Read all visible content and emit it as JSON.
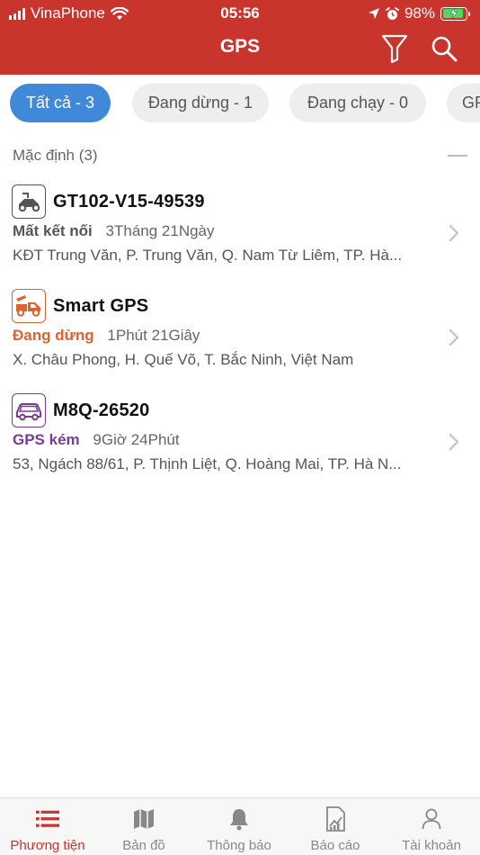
{
  "status_bar": {
    "carrier": "VinaPhone",
    "time": "05:56",
    "battery": "98%"
  },
  "header": {
    "title": "GPS",
    "filter_icon": "filter-icon",
    "search_icon": "search-icon"
  },
  "filters": [
    {
      "label": "Tất cả - 3",
      "active": true
    },
    {
      "label": "Đang dừng - 1",
      "active": false
    },
    {
      "label": "Đang chạy - 0",
      "active": false
    },
    {
      "label": "GP",
      "active": false
    }
  ],
  "group": {
    "title": "Mặc định (3)"
  },
  "vehicles": [
    {
      "name": "GT102-V15-49539",
      "icon": "scooter-icon",
      "status": "Mất kết nối",
      "status_color": "#555555",
      "duration": "3Tháng 21Ngày",
      "address": "KĐT Trung Văn, P. Trung Văn, Q. Nam Từ Liêm, TP. Hà..."
    },
    {
      "name": "Smart GPS",
      "icon": "tow-truck-icon",
      "status": "Đang dừng",
      "status_color": "#e0622e",
      "duration": "1Phút 21Giây",
      "address": "X. Châu Phong, H. Quế Võ, T. Bắc Ninh, Việt Nam"
    },
    {
      "name": "M8Q-26520",
      "icon": "car-icon",
      "status": "GPS kém",
      "status_color": "#7a3a96",
      "duration": "9Giờ 24Phút",
      "address": "53, Ngách 88/61, P. Thịnh Liệt, Q. Hoàng Mai, TP. Hà N..."
    }
  ],
  "tabbar": [
    {
      "label": "Phương tiện",
      "icon": "list-icon",
      "active": true
    },
    {
      "label": "Bản đồ",
      "icon": "map-icon",
      "active": false
    },
    {
      "label": "Thông báo",
      "icon": "bell-icon",
      "active": false
    },
    {
      "label": "Báo cáo",
      "icon": "report-icon",
      "active": false
    },
    {
      "label": "Tài khoản",
      "icon": "user-icon",
      "active": false
    }
  ],
  "colors": {
    "header": "#c9342c",
    "active_chip": "#3f89d8",
    "active_tab": "#c9342c"
  }
}
